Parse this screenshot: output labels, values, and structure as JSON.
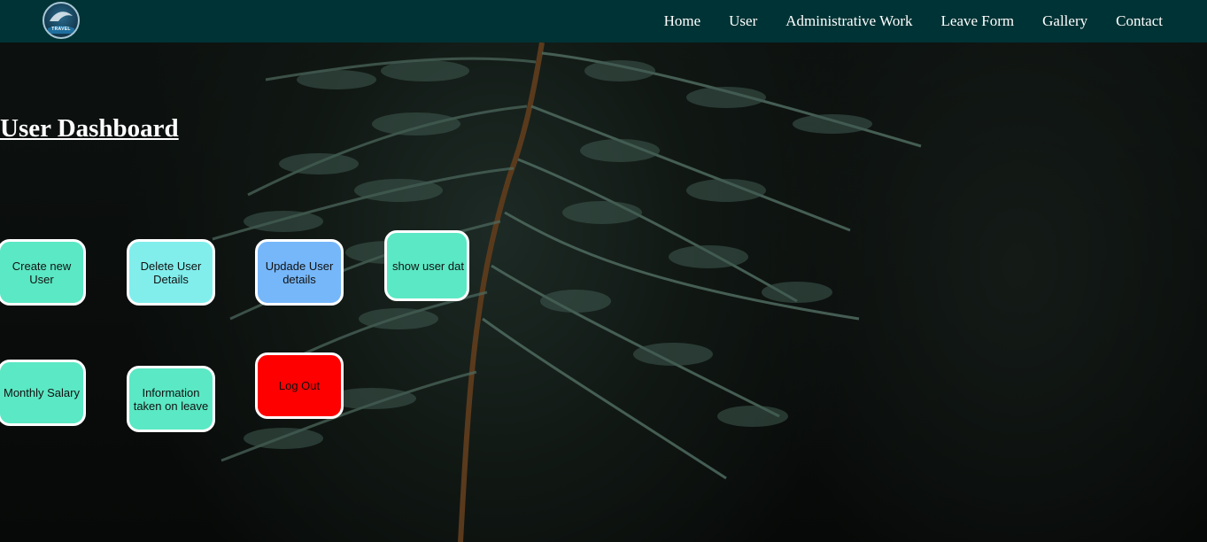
{
  "logo": {
    "text": "TRAVEL"
  },
  "nav": {
    "items": [
      {
        "label": "Home"
      },
      {
        "label": "User"
      },
      {
        "label": "Administrative Work"
      },
      {
        "label": "Leave Form"
      },
      {
        "label": "Gallery"
      },
      {
        "label": "Contact"
      }
    ]
  },
  "main": {
    "title": "User Dashboard",
    "buttons": [
      {
        "label": "Create new User",
        "color": "#5BE8C4"
      },
      {
        "label": "Delete User Details",
        "color": "#81EEEC"
      },
      {
        "label": "Updade User details",
        "color": "#76B7FA"
      },
      {
        "label": "show user dat",
        "color": "#5BE8C4"
      },
      {
        "label": "Monthly Salary",
        "color": "#5BE8C4"
      },
      {
        "label": "Information taken on leave",
        "color": "#5BE8C4"
      },
      {
        "label": "Log Out",
        "color": "#FF0000"
      }
    ]
  },
  "colors": {
    "navbar": "#003335",
    "background": "#0a0d0b"
  }
}
